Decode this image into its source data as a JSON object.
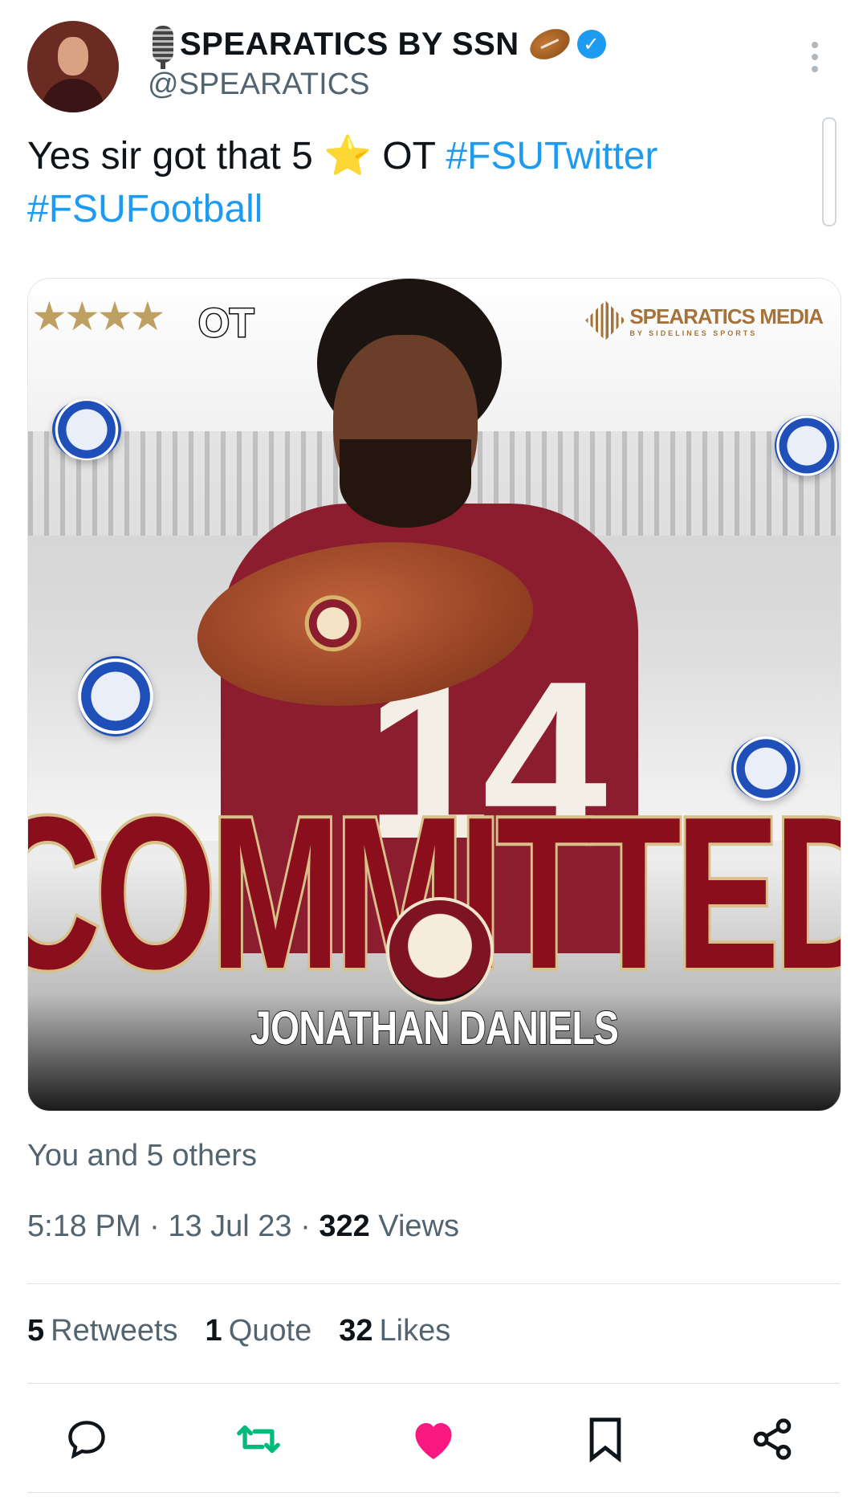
{
  "author": {
    "display_name": "SPEARATICS BY SSN",
    "handle": "@SPEARATICS",
    "verified": true,
    "name_icons": [
      "microphone-icon",
      "football-icon",
      "verified-badge-icon"
    ]
  },
  "tweet": {
    "text_plain": "Yes sir got that 5 ",
    "star_emoji": "⭐",
    "text_after_star": " OT ",
    "hashtags": [
      "#FSUTwitter",
      "#FSUFootball"
    ]
  },
  "media": {
    "rating_stars": "★★★★",
    "rating_position": "OT",
    "brand_name": "SPEARATICS MEDIA",
    "brand_sub": "BY SIDELINES SPORTS",
    "jersey_number": "14",
    "headline": "COMMITTED",
    "player_name": "JONATHAN DANIELS"
  },
  "social_context": "You and 5 others",
  "meta": {
    "time": "5:18 PM",
    "date": "13 Jul 23",
    "views_count": "322",
    "views_label": "Views",
    "separator": "·"
  },
  "stats": {
    "retweets_count": "5",
    "retweets_label": "Retweets",
    "quotes_count": "1",
    "quotes_label": "Quote",
    "likes_count": "32",
    "likes_label": "Likes"
  },
  "actions": [
    "reply-icon",
    "retweet-icon",
    "like-icon",
    "bookmark-icon",
    "share-icon"
  ],
  "colors": {
    "link": "#1d9bf0",
    "secondary_text": "#536471",
    "retweet_green": "#00ba7c",
    "like_pink": "#f91880",
    "fsu_garnet": "#8c1d2f",
    "fsu_gold": "#d7c08a"
  }
}
